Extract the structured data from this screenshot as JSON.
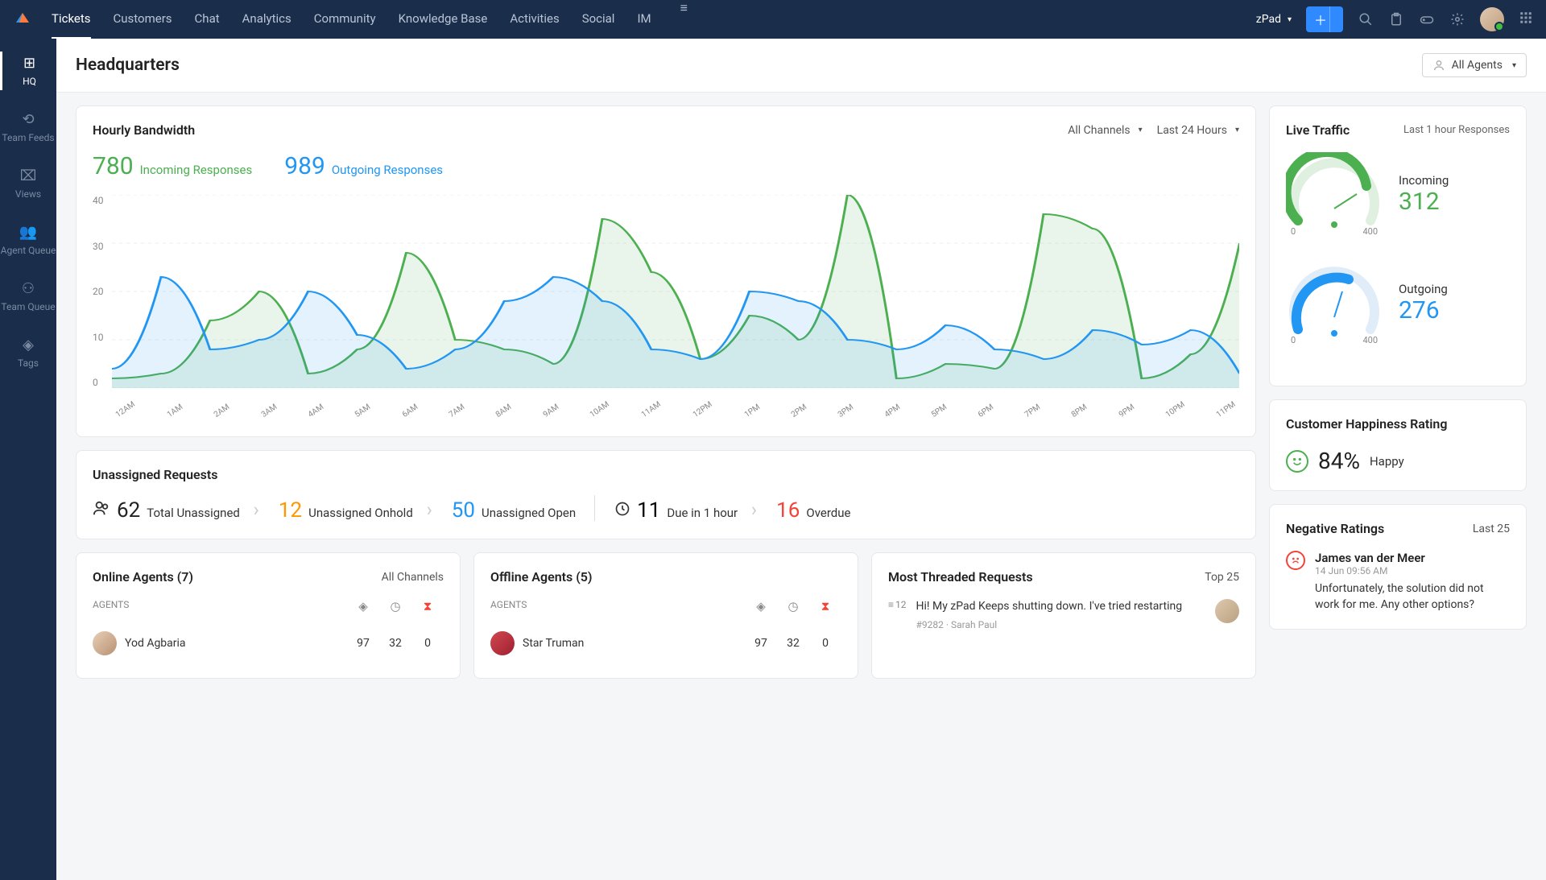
{
  "nav": {
    "items": [
      "Tickets",
      "Customers",
      "Chat",
      "Analytics",
      "Community",
      "Knowledge Base",
      "Activities",
      "Social",
      "IM"
    ],
    "active": 0,
    "product": "zPad"
  },
  "sidebar": {
    "items": [
      {
        "label": "HQ",
        "icon": "⊞"
      },
      {
        "label": "Team Feeds",
        "icon": "⟲"
      },
      {
        "label": "Views",
        "icon": "⌧"
      },
      {
        "label": "Agent Queue",
        "icon": "👥"
      },
      {
        "label": "Team Queue",
        "icon": "⚇"
      },
      {
        "label": "Tags",
        "icon": "◈"
      }
    ]
  },
  "page": {
    "title": "Headquarters",
    "agent_filter": "All Agents"
  },
  "bandwidth": {
    "title": "Hourly Bandwidth",
    "filter_channel": "All Channels",
    "filter_time": "Last 24 Hours",
    "incoming_total": "780",
    "incoming_label": "Incoming Responses",
    "outgoing_total": "989",
    "outgoing_label": "Outgoing Responses"
  },
  "live_traffic": {
    "title": "Live Traffic",
    "subtitle": "Last 1 hour Responses",
    "incoming_label": "Incoming",
    "incoming_value": "312",
    "outgoing_label": "Outgoing",
    "outgoing_value": "276",
    "min": "0",
    "max": "400"
  },
  "unassigned": {
    "title": "Unassigned Requests",
    "total_num": "62",
    "total_label": "Total Unassigned",
    "onhold_num": "12",
    "onhold_label": "Unassigned Onhold",
    "open_num": "50",
    "open_label": "Unassigned Open",
    "due_num": "11",
    "due_label": "Due in 1 hour",
    "overdue_num": "16",
    "overdue_label": "Overdue"
  },
  "happiness": {
    "title": "Customer Happiness Rating",
    "pct": "84%",
    "label": "Happy"
  },
  "online_agents": {
    "title": "Online Agents (7)",
    "filter": "All Channels",
    "header": "AGENTS",
    "rows": [
      {
        "name": "Yod Agbaria",
        "c1": "97",
        "c2": "32",
        "c3": "0"
      }
    ]
  },
  "offline_agents": {
    "title": "Offline Agents (5)",
    "header": "AGENTS",
    "rows": [
      {
        "name": "Star Truman",
        "c1": "97",
        "c2": "32",
        "c3": "0"
      }
    ]
  },
  "threaded": {
    "title": "Most Threaded Requests",
    "filter": "Top 25",
    "items": [
      {
        "count": "12",
        "text": "Hi! My zPad Keeps shutting down. I've tried restarting",
        "id": "#9282",
        "agent": "Sarah Paul"
      }
    ]
  },
  "negative": {
    "title": "Negative Ratings",
    "filter": "Last 25",
    "items": [
      {
        "name": "James van der Meer",
        "date": "14 Jun 09:56 AM",
        "text": "Unfortunately, the solution did not work for me. Any other options?"
      }
    ]
  },
  "chart_data": {
    "type": "line",
    "xlabel": "",
    "ylabel": "",
    "ylim": [
      0,
      40
    ],
    "y_ticks": [
      "40",
      "30",
      "20",
      "10",
      "0"
    ],
    "categories": [
      "12AM",
      "1AM",
      "2AM",
      "3AM",
      "4AM",
      "5AM",
      "6AM",
      "7AM",
      "8AM",
      "9AM",
      "10AM",
      "11AM",
      "12PM",
      "1PM",
      "2PM",
      "3PM",
      "4PM",
      "5PM",
      "6PM",
      "7PM",
      "8PM",
      "9PM",
      "10PM",
      "11PM"
    ],
    "series": [
      {
        "name": "Incoming",
        "color": "#4caf50",
        "values": [
          2,
          3,
          14,
          20,
          3,
          8,
          28,
          10,
          8,
          5,
          35,
          24,
          6,
          15,
          10,
          40,
          2,
          5,
          4,
          36,
          33,
          2,
          7,
          30
        ]
      },
      {
        "name": "Outgoing",
        "color": "#2196f3",
        "values": [
          4,
          23,
          8,
          10,
          20,
          11,
          4,
          8,
          18,
          23,
          18,
          8,
          6,
          20,
          18,
          10,
          8,
          13,
          8,
          6,
          12,
          9,
          12,
          3
        ]
      }
    ]
  }
}
